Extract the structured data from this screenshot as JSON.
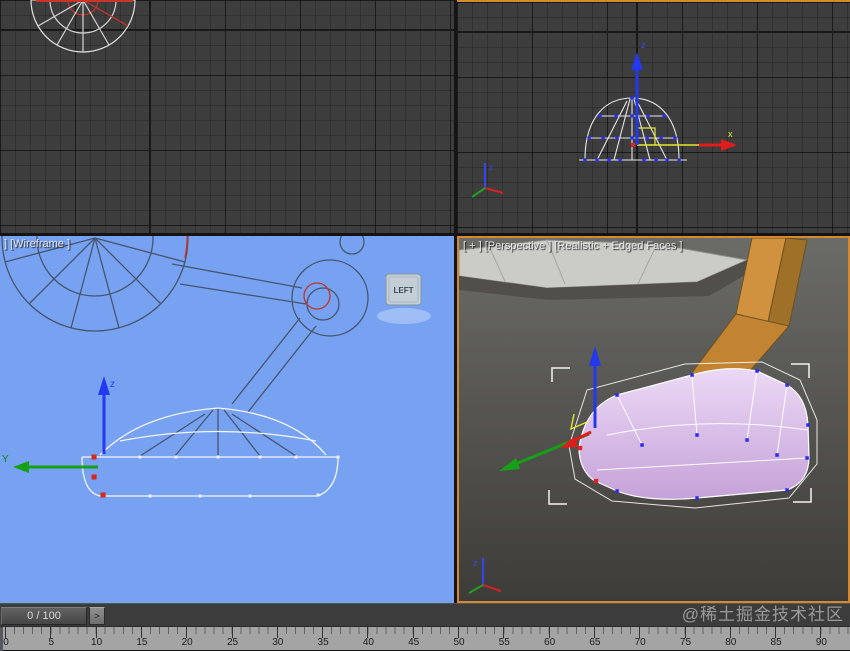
{
  "viewports": {
    "top_left": {
      "type": "orthographic-wireframe"
    },
    "top_right": {
      "type": "orthographic-wireframe"
    },
    "bottom_left": {
      "label": "] [Wireframe ]",
      "view_cube_label": "LEFT"
    },
    "bottom_right": {
      "label": "[ + ] [Perspective ] [Realistic + Edged Faces ]"
    }
  },
  "axis_labels": {
    "x": "x",
    "y": "y",
    "z": "z",
    "y_upper": "Y"
  },
  "timeline": {
    "frame_display": "0 / 100",
    "next_button": ">",
    "tick_labels": [
      "0",
      "5",
      "10",
      "15",
      "20",
      "25",
      "30",
      "35",
      "40",
      "45",
      "50",
      "55",
      "60",
      "65",
      "70",
      "75",
      "80",
      "85",
      "90"
    ]
  },
  "watermark": "@稀土掘金技术社区",
  "colors": {
    "active_viewport_border": "#d4882f",
    "left_viewport_bg": "#77a2f2",
    "axis_x": "#e01c1c",
    "axis_y": "#17a017",
    "axis_z": "#2438f0",
    "vertex_blue": "#2a2af0",
    "selected_vertex_red": "#e02222",
    "arm_orange": "#d0923e",
    "base_purple": "#d3b0e4",
    "wireframe_left_view": "#47546e"
  }
}
